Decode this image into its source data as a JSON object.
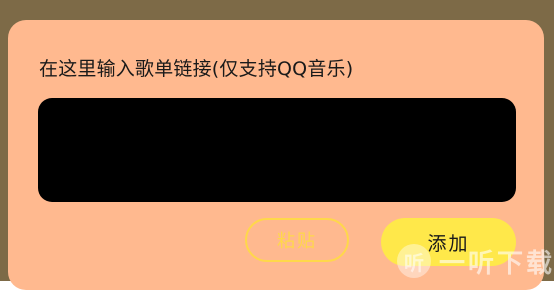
{
  "dialog": {
    "title": "在这里输入歌单链接(仅支持QQ音乐)",
    "input": {
      "value": "",
      "placeholder": ""
    },
    "paste_label": "粘贴",
    "add_label": "添加"
  },
  "watermark": {
    "logo_glyph": "听",
    "text": "一听下载"
  },
  "colors": {
    "backdrop": "#7d6a47",
    "dialog_bg": "#ffb98f",
    "input_bg": "#000000",
    "accent_yellow": "#ffe84a",
    "outline_yellow": "#ffd84a"
  },
  "icons": {
    "watermark_logo": "listen-logo-icon"
  }
}
